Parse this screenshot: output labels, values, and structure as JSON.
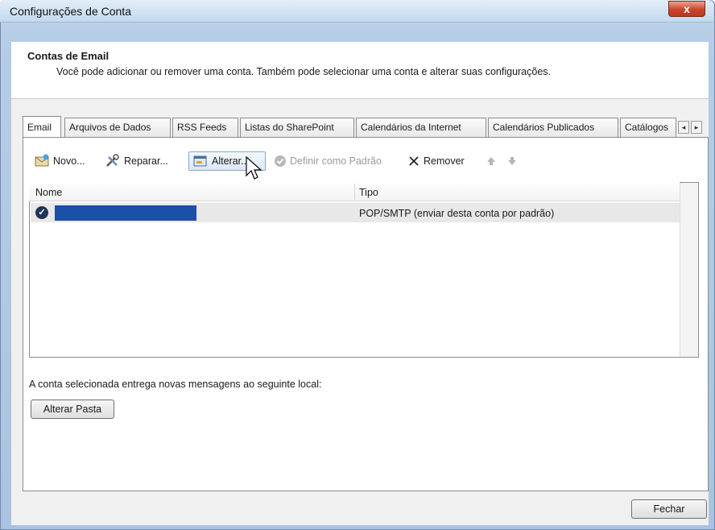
{
  "window": {
    "title": "Configurações de Conta",
    "close_label": "x"
  },
  "header": {
    "title": "Contas de Email",
    "description": "Você pode adicionar ou remover uma conta. Também pode selecionar uma conta e alterar suas configurações."
  },
  "tabs": [
    {
      "label": "Email",
      "active": true
    },
    {
      "label": "Arquivos de Dados"
    },
    {
      "label": "RSS Feeds"
    },
    {
      "label": "Listas do SharePoint"
    },
    {
      "label": "Calendários da Internet"
    },
    {
      "label": "Calendários Publicados"
    },
    {
      "label": "Catálogos"
    }
  ],
  "tab_scroll": {
    "left": "◂",
    "right": "▸"
  },
  "toolbar": {
    "new_label": "Novo...",
    "repair_label": "Reparar...",
    "change_label": "Alterar...",
    "set_default_label": "Definir como Padrão",
    "remove_label": "Remover"
  },
  "accounts_table": {
    "columns": [
      "Nome",
      "Tipo"
    ],
    "rows": [
      {
        "tipo": "POP/SMTP (enviar desta conta por padrão)"
      }
    ]
  },
  "delivery": {
    "label": "A conta selecionada entrega novas mensagens ao seguinte local:",
    "change_folder_label": "Alterar Pasta"
  },
  "footer": {
    "close_label": "Fechar"
  },
  "colors": {
    "selection": "#1b4fa8",
    "title_gradient": "#c4d9ee",
    "close_red": "#c8462c"
  }
}
